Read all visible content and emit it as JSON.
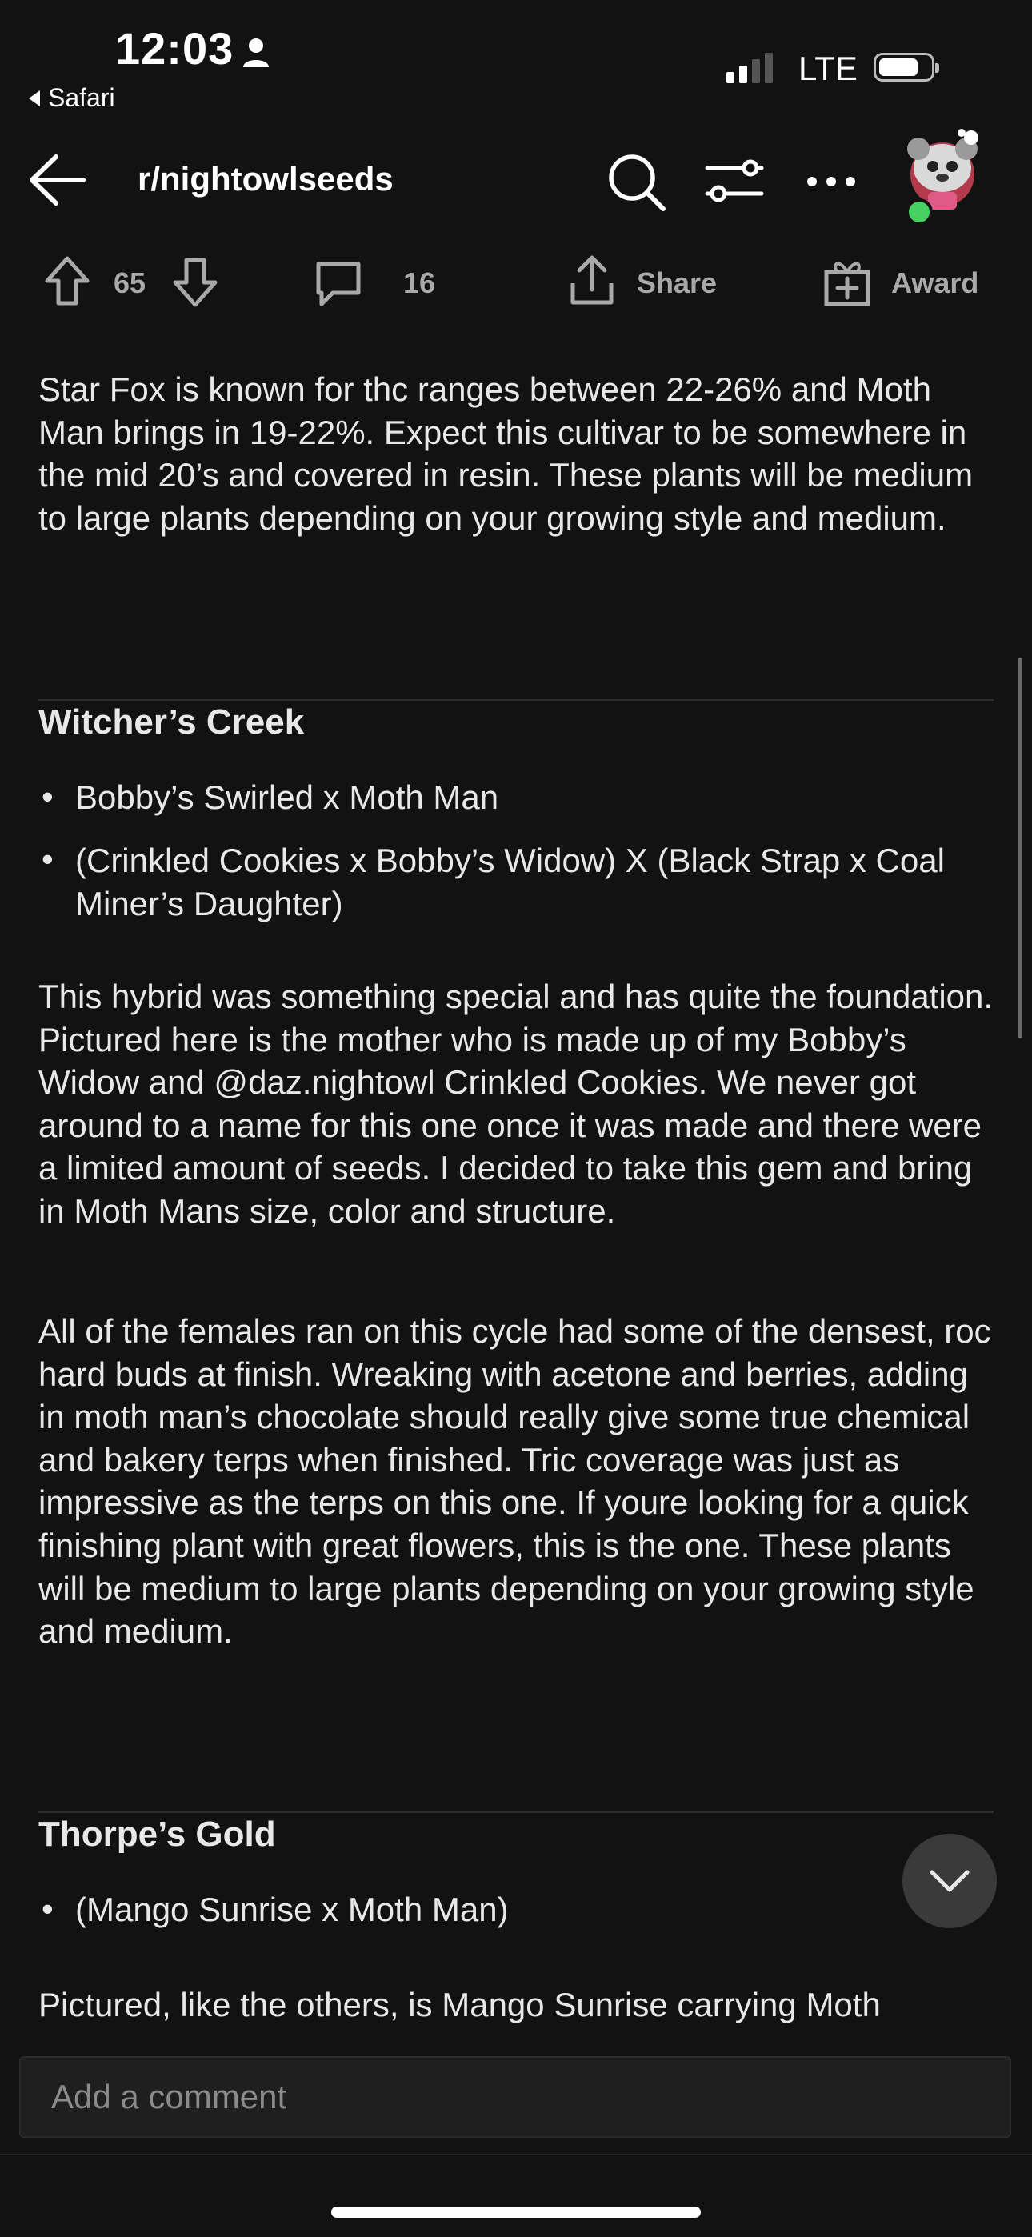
{
  "status_bar": {
    "time": "12:03",
    "back_app": "Safari",
    "network": "LTE"
  },
  "header": {
    "subreddit": "r/nightowlseeds"
  },
  "actions": {
    "upvotes": "65",
    "comments": "16",
    "share": "Share",
    "award": "Award"
  },
  "content": {
    "intro": "Star Fox is known for thc ranges between 22-26% and Moth Man brings in 19-22%. Expect this cultivar to be somewhere in the mid 20’s and covered in resin. These plants will be medium to large plants depending on your growing style and medium.",
    "sections": [
      {
        "title": "Witcher’s Creek",
        "bullets": [
          "Bobby’s Swirled x Moth Man",
          "(Crinkled Cookies x Bobby’s Widow) X (Black Strap x Coal Miner’s Daughter)"
        ],
        "paragraphs": [
          "This hybrid was something special and has quite the foundation. Pictured here is the mother who is made up of my Bobby’s Widow and @daz.nightowl Crinkled Cookies. We never got around to a name for this one once it was made and there were a limited amount of seeds. I decided to take this gem and bring in Moth Mans size, color and structure.",
          "All of the females ran on this cycle had some of the densest, roc hard buds at finish. Wreaking with acetone and berries, adding in moth man’s chocolate should really give some true chemical and bakery terps when finished. Tric coverage was just as impressive as the terps on this one. If youre looking for a quick finishing plant with great flowers, this is the one. These plants will be medium to large plants depending on your growing style and medium."
        ]
      },
      {
        "title": "Thorpe’s Gold",
        "bullets": [
          "(Mango Sunrise x Moth Man)"
        ],
        "paragraphs": [
          "Pictured, like the others, is Mango Sunrise carrying Moth"
        ]
      }
    ]
  },
  "comment": {
    "placeholder": "Add a comment"
  }
}
